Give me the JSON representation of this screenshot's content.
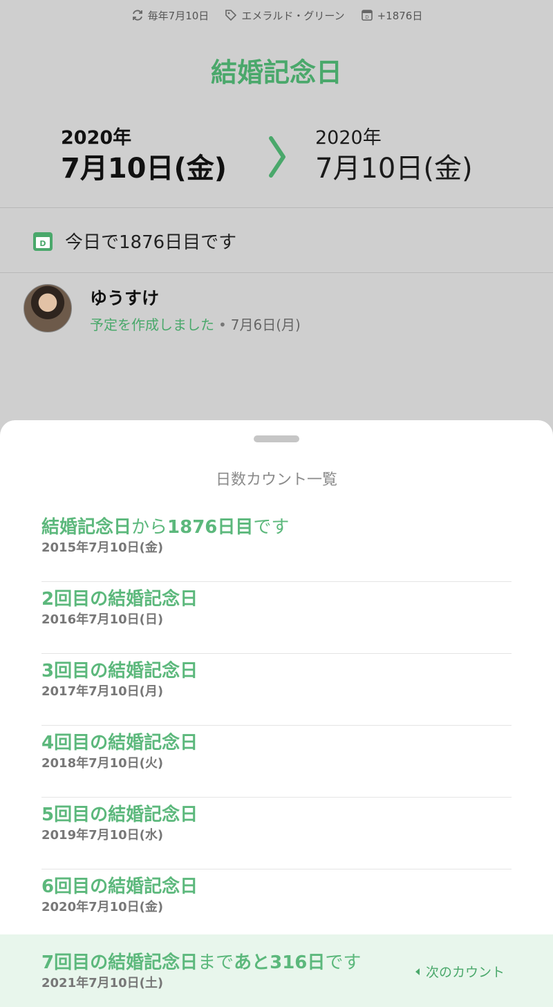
{
  "header": {
    "repeat": "毎年7月10日",
    "color_tag": "エメラルド・グリーン",
    "day_badge": "+1876日",
    "title": "結婚記念日",
    "start_year": "2020年",
    "start_date": "7月10日(金)",
    "end_year": "2020年",
    "end_date": "7月10日(金)",
    "accent": "#4aa86b"
  },
  "daycount": "今日で1876日目です",
  "creator": {
    "name": "ゆうすけ",
    "action": "予定を作成しました",
    "when": "7月6日(月)"
  },
  "sheet": {
    "title": "日数カウント一覧",
    "first": {
      "name": "結婚記念日",
      "mid": "から",
      "count": "1876日目",
      "tail": "です",
      "date": "2015年7月10日(金)"
    },
    "items": [
      {
        "title": "2回目の結婚記念日",
        "date": "2016年7月10日(日)"
      },
      {
        "title": "3回目の結婚記念日",
        "date": "2017年7月10日(月)"
      },
      {
        "title": "4回目の結婚記念日",
        "date": "2018年7月10日(火)"
      },
      {
        "title": "5回目の結婚記念日",
        "date": "2019年7月10日(水)"
      },
      {
        "title": "6回目の結婚記念日",
        "date": "2020年7月10日(金)"
      }
    ],
    "next": {
      "name": "7回目の結婚記念日",
      "mid": "まで",
      "remain": "あと316日",
      "tail": "です",
      "date": "2021年7月10日(土)",
      "button": "次のカウント"
    }
  }
}
